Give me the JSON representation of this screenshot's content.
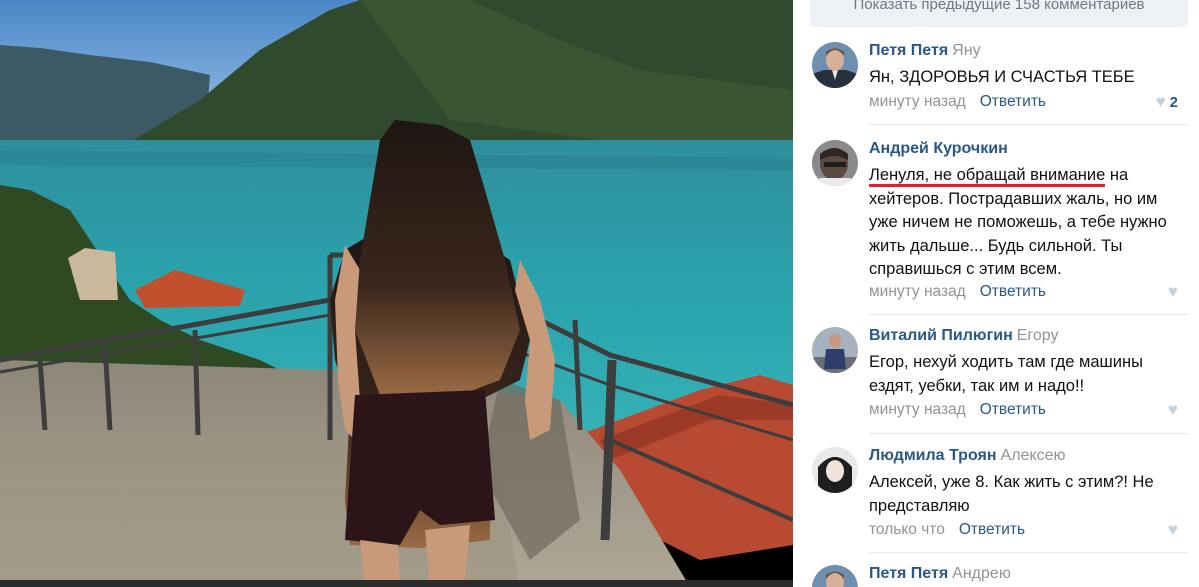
{
  "show_previous": "Показать предыдущие 158 комментариев",
  "comments": [
    {
      "author": "Петя Петя",
      "reply_to": "Яну",
      "text_plain": "Ян, ЗДОРОВЬЯ И СЧАСТЬЯ ТЕБЕ",
      "time": "минуту назад",
      "reply": "Ответить",
      "likes": "2"
    },
    {
      "author": "Андрей Курочкин",
      "reply_to": "",
      "text_underlined": "Ленуля, не обращай внимание",
      "text_rest": " на хейтеров. Пострадавших жаль, но им уже ничем не поможешь, а тебе нужно жить дальше... Будь сильной. Ты справишься с этим всем.",
      "time": "минуту назад",
      "reply": "Ответить",
      "likes": ""
    },
    {
      "author": "Виталий Пилюгин",
      "reply_to": "Егору",
      "text_plain": "Егор, нехуй ходить там где машины ездят, уебки, так им и надо!!",
      "time": "минуту назад",
      "reply": "Ответить",
      "likes": ""
    },
    {
      "author": "Людмила Троян",
      "reply_to": "Алексею",
      "text_plain": "Алексей, уже 8. Как жить с этим?! Не представляю",
      "time": "только что",
      "reply": "Ответить",
      "likes": ""
    },
    {
      "author": "Петя Петя",
      "reply_to": "Андрею",
      "time": "",
      "reply": "",
      "likes": ""
    }
  ],
  "icons": {
    "like": "heart-icon"
  }
}
